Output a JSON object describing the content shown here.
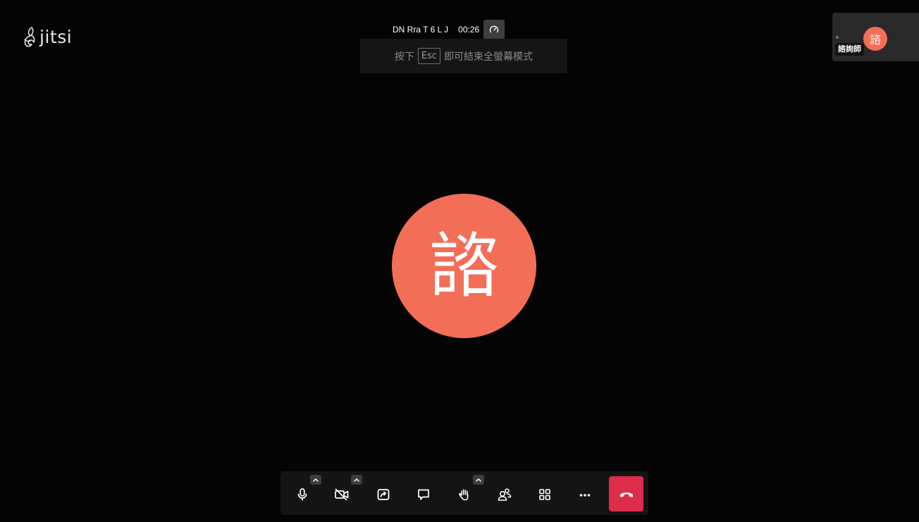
{
  "logo": {
    "text": "jitsi"
  },
  "conference": {
    "room_name": "DN Rra T 6 L J",
    "timer": "00:26"
  },
  "fullscreen_hint": {
    "prefix": "按下",
    "key": "Esc",
    "suffix": "即可結束全螢幕模式"
  },
  "main_participant": {
    "avatar_initial": "諮"
  },
  "filmstrip": {
    "participant": {
      "avatar_initial": "諮",
      "name": "諮詢師"
    }
  },
  "toolbar": {
    "buttons": [
      {
        "name": "microphone",
        "icon": "microphone-icon",
        "has_options": true
      },
      {
        "name": "camera",
        "icon": "camera-off-icon",
        "has_options": true
      },
      {
        "name": "share-screen",
        "icon": "share-screen-icon",
        "has_options": false
      },
      {
        "name": "chat",
        "icon": "chat-icon",
        "has_options": false
      },
      {
        "name": "raise-hand",
        "icon": "hand-icon",
        "has_options": true
      },
      {
        "name": "participants",
        "icon": "participants-icon",
        "has_options": false
      },
      {
        "name": "tile-view",
        "icon": "tile-view-icon",
        "has_options": false
      },
      {
        "name": "more",
        "icon": "more-icon",
        "has_options": false
      },
      {
        "name": "hangup",
        "icon": "hangup-icon",
        "has_options": false
      }
    ],
    "colors": {
      "hangup": "#dd2d4a",
      "avatar": "#f26e57"
    }
  }
}
